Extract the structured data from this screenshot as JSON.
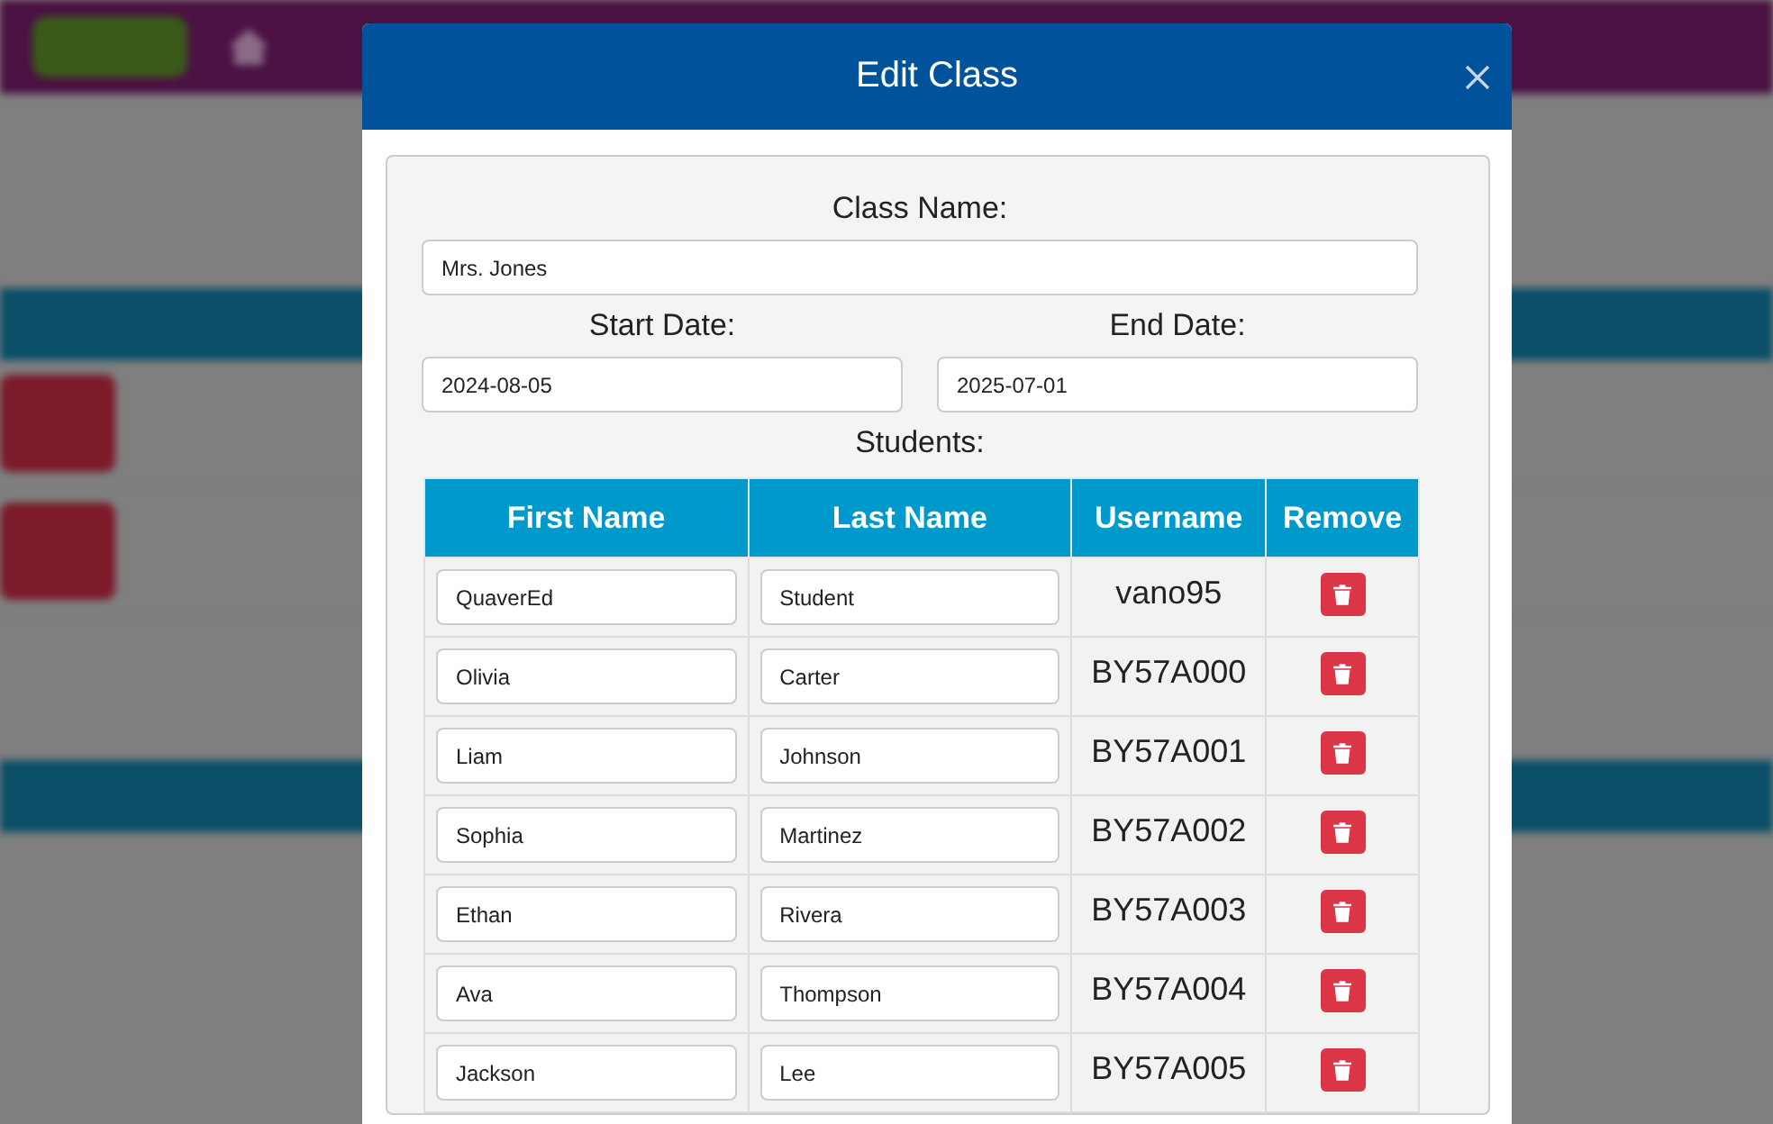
{
  "dialog": {
    "title": "Edit Class",
    "class_name": {
      "label": "Class Name:",
      "value": "Mrs. Jones"
    },
    "start_date": {
      "label": "Start Date:",
      "value": "2024-08-05"
    },
    "end_date": {
      "label": "End Date:",
      "value": "2025-07-01"
    },
    "students_label": "Students:",
    "table": {
      "columns": [
        "First Name",
        "Last Name",
        "Username",
        "Remove"
      ],
      "rows": [
        {
          "first_name": "QuaverEd",
          "last_name": "Student",
          "username": "vano95"
        },
        {
          "first_name": "Olivia",
          "last_name": "Carter",
          "username": "BY57A000"
        },
        {
          "first_name": "Liam",
          "last_name": "Johnson",
          "username": "BY57A001"
        },
        {
          "first_name": "Sophia",
          "last_name": "Martinez",
          "username": "BY57A002"
        },
        {
          "first_name": "Ethan",
          "last_name": "Rivera",
          "username": "BY57A003"
        },
        {
          "first_name": "Ava",
          "last_name": "Thompson",
          "username": "BY57A004"
        },
        {
          "first_name": "Jackson",
          "last_name": "Lee",
          "username": "BY57A005"
        }
      ]
    }
  }
}
